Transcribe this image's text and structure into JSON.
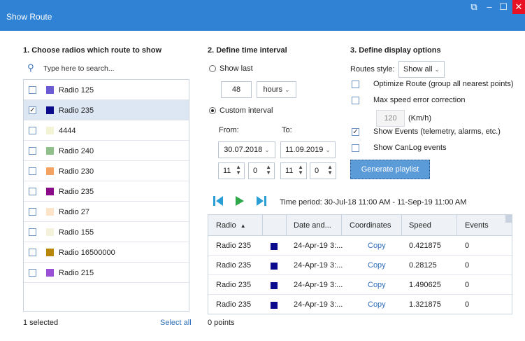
{
  "window": {
    "title": "Show Route",
    "popout_symbol": "⧉",
    "minimize_symbol": "–",
    "maximize_symbol": "☐",
    "close_symbol": "✕"
  },
  "section1": {
    "heading": "1. Choose radios which route to show",
    "search_placeholder": "Type here to search...",
    "items": [
      {
        "label": "Radio 125",
        "color": "#6b5bd2",
        "checked": false,
        "selected": false
      },
      {
        "label": "Radio 235",
        "color": "#0a0a8a",
        "checked": true,
        "selected": true
      },
      {
        "label": "4444",
        "color": "#f3f3d6",
        "checked": false,
        "selected": false
      },
      {
        "label": "Radio 240",
        "color": "#8fbf8a",
        "checked": false,
        "selected": false
      },
      {
        "label": "Radio 230",
        "color": "#f4a261",
        "checked": false,
        "selected": false
      },
      {
        "label": "Radio 235",
        "color": "#8a0a8a",
        "checked": false,
        "selected": false
      },
      {
        "label": "Radio 27",
        "color": "#fde4c8",
        "checked": false,
        "selected": false
      },
      {
        "label": "Radio 155",
        "color": "#f5f2dc",
        "checked": false,
        "selected": false
      },
      {
        "label": "Radio 16500000",
        "color": "#b8860b",
        "checked": false,
        "selected": false
      },
      {
        "label": "Radio 215",
        "color": "#9b4fd6",
        "checked": false,
        "selected": false
      }
    ],
    "footer_selected": "1 selected",
    "select_all": "Select all"
  },
  "section2": {
    "heading": "2. Define time interval",
    "show_last_label": "Show last",
    "show_last_value": "48",
    "unit_value": "hours",
    "custom_label": "Custom interval",
    "from_label": "From:",
    "to_label": "To:",
    "from_date": "30.07.2018",
    "to_date": "11.09.2019",
    "from_hour": "11",
    "from_min": "0",
    "to_hour": "11",
    "to_min": "0",
    "mode": "custom"
  },
  "section3": {
    "heading": "3. Define display options",
    "routes_style_label": "Routes style:",
    "routes_style_value": "Show all",
    "optimize_label": "Optimize Route (group all nearest points)",
    "optimize_checked": false,
    "maxspeed_label": "Max speed error correction",
    "maxspeed_checked": false,
    "speed_value": "120",
    "speed_unit": "(Km/h)",
    "events_label": "Show Events (telemetry, alarms, etc.)",
    "events_checked": true,
    "canlog_label": "Show CanLog events",
    "canlog_checked": false,
    "generate_button": "Generate playlist"
  },
  "playback": {
    "period_text": "Time period: 30-Jul-18 11:00 AM - 11-Sep-19 11:00 AM",
    "icons": [
      "skip-back-icon",
      "play-icon",
      "skip-forward-icon"
    ]
  },
  "table": {
    "columns": [
      "Radio",
      "",
      "Date and...",
      "Coordinates",
      "Speed",
      "Events"
    ],
    "rows": [
      {
        "radio": "Radio 235",
        "color": "#0a0a8a",
        "date": "24-Apr-19 3:...",
        "coords": "Copy",
        "speed": "0.421875",
        "events": "0"
      },
      {
        "radio": "Radio 235",
        "color": "#0a0a8a",
        "date": "24-Apr-19 3:...",
        "coords": "Copy",
        "speed": "0.28125",
        "events": "0"
      },
      {
        "radio": "Radio 235",
        "color": "#0a0a8a",
        "date": "24-Apr-19 3:...",
        "coords": "Copy",
        "speed": "1.490625",
        "events": "0"
      },
      {
        "radio": "Radio 235",
        "color": "#0a0a8a",
        "date": "24-Apr-19 3:...",
        "coords": "Copy",
        "speed": "1.321875",
        "events": "0"
      }
    ],
    "points_text": "0 points"
  }
}
